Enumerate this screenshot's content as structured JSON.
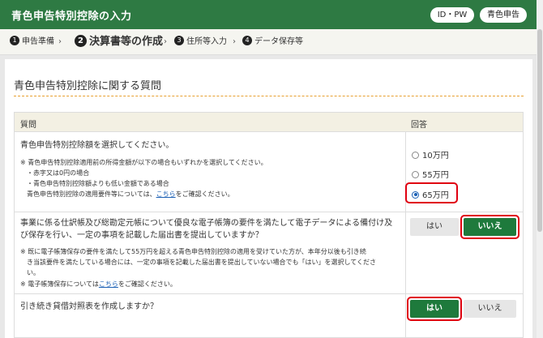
{
  "header": {
    "title": "青色申告特別控除の入力",
    "id_button": "ID・PW",
    "blue_button": "青色申告"
  },
  "steps": [
    {
      "num": "1",
      "label": "申告準備"
    },
    {
      "num": "2",
      "label": "決算書等の作成"
    },
    {
      "num": "3",
      "label": "住所等入力"
    },
    {
      "num": "4",
      "label": "データ保存等"
    }
  ],
  "section_title": "青色申告特別控除に関する質問",
  "table": {
    "col_question": "質問",
    "col_answer": "回答"
  },
  "q1": {
    "text": "青色申告特別控除額を選択してください。",
    "note1": "※ 青色申告特別控除適用前の所得金額が以下の場合もいずれかを選択してください。",
    "note2": "・赤字又は0円の場合",
    "note3": "・青色申告特別控除額よりも低い金額である場合",
    "note4_pre": "青色申告特別控除の適用要件等については、",
    "note4_link": "こちら",
    "note4_post": "をご確認ください。",
    "options": [
      "10万円",
      "55万円",
      "65万円"
    ],
    "selected": "65万円"
  },
  "q2": {
    "line1": "事業に係る仕訳帳及び総勘定元帳について優良な電子帳簿の要件を満たして電子データによる備付け及",
    "line2": "び保存を行い、一定の事項を記載した届出書を提出していますか？",
    "note1": "※ 既に電子帳簿保存の要件を満たして55万円を超える青色申告特別控除の適用を受けていた方が、本年分以後も引き続",
    "note2": "き当該要件を満たしている場合には、一定の事項を記載した届出書を提出していない場合でも「はい」を選択してくださ",
    "note3": "い。",
    "note4_pre": "※ 電子帳簿保存については",
    "note4_link": "こちら",
    "note4_post": "をご確認ください。",
    "yes": "はい",
    "no": "いいえ",
    "selected": "いいえ"
  },
  "q3": {
    "text": "引き続き貸借対照表を作成しますか？",
    "yes": "はい",
    "no": "いいえ",
    "selected": "はい"
  }
}
